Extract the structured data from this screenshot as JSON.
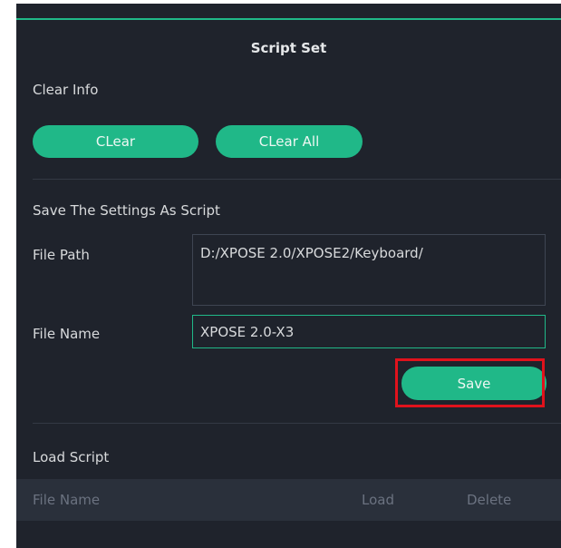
{
  "panel": {
    "title": "Script Set"
  },
  "clear_info": {
    "label": "Clear Info",
    "clear_button": "CLear",
    "clear_all_button": "CLear All"
  },
  "save_settings": {
    "section_label": "Save The Settings As Script",
    "file_path_label": "File Path",
    "file_path_value": "D:/XPOSE 2.0/XPOSE2/Keyboard/",
    "file_name_label": "File Name",
    "file_name_value": "XPOSE 2.0-X3",
    "save_button": "Save"
  },
  "load_script": {
    "section_label": "Load Script",
    "columns": [
      "File Name",
      "Load",
      "Delete"
    ]
  },
  "colors": {
    "accent": "#20b888",
    "panel_bg": "#1f232c",
    "highlight": "#e0121c"
  }
}
